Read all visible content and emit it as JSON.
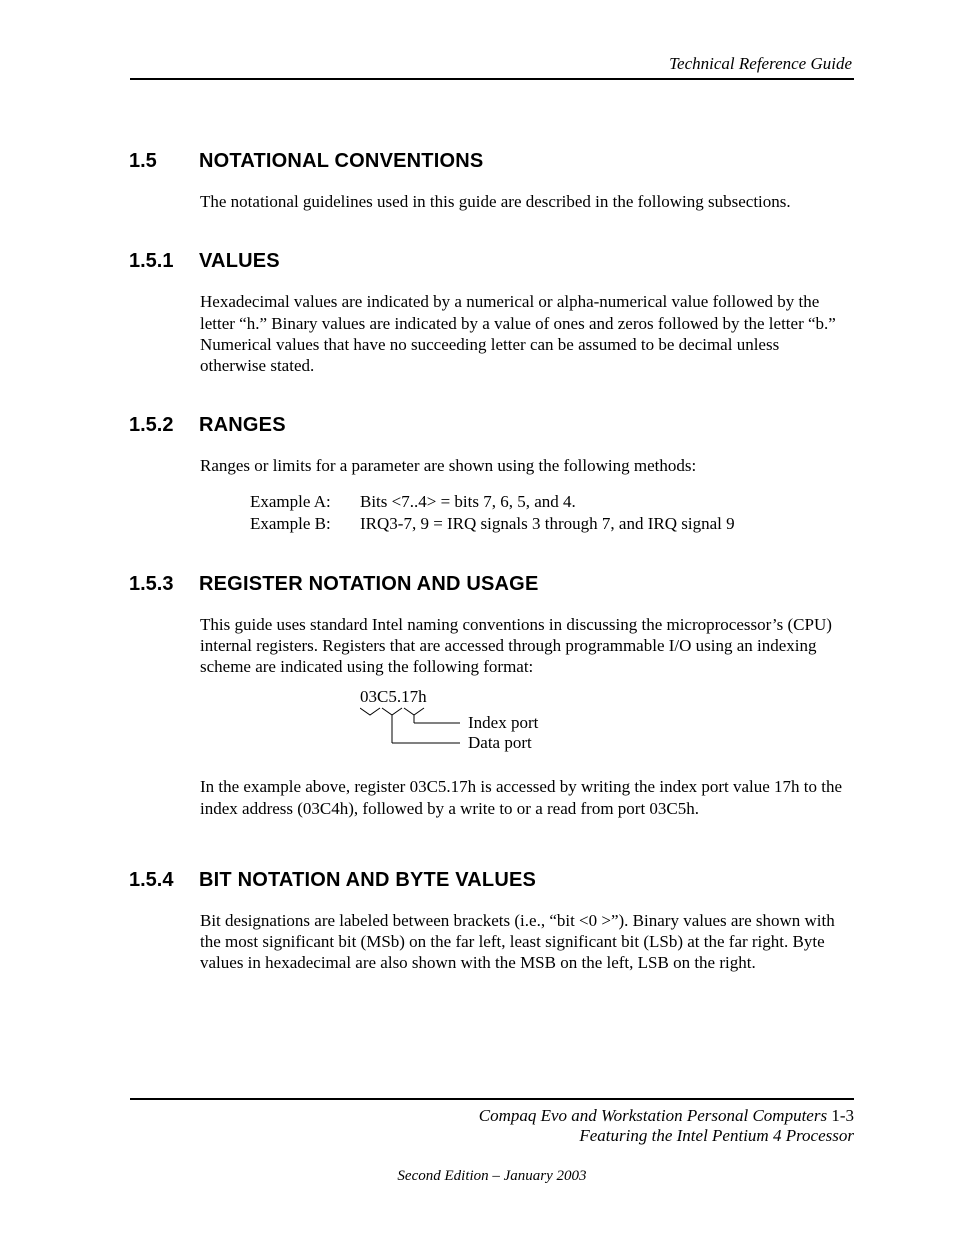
{
  "header": {
    "running_title": "Technical Reference Guide"
  },
  "sections": {
    "s15": {
      "num": "1.5",
      "title": "NOTATIONAL CONVENTIONS",
      "body": "The notational guidelines used in this guide are described in the following subsections."
    },
    "s151": {
      "num": "1.5.1",
      "title": "VALUES",
      "body": "Hexadecimal values are indicated by a numerical or alpha-numerical value followed by the letter “h.”  Binary values are indicated by a value of ones and zeros followed by the letter “b.”  Numerical values that have no succeeding letter can be assumed to be decimal unless otherwise stated."
    },
    "s152": {
      "num": "1.5.2",
      "title": "RANGES",
      "body": "Ranges or limits for a parameter are shown using the following methods:",
      "example_a_label": "Example A:",
      "example_a_text": "Bits <7..4> = bits 7, 6, 5, and 4.",
      "example_b_label": "Example B:",
      "example_b_text": "IRQ3-7, 9 = IRQ signals 3 through 7, and IRQ signal 9"
    },
    "s153": {
      "num": "1.5.3",
      "title": "REGISTER NOTATION AND USAGE",
      "body1": "This guide uses standard Intel naming conventions in discussing the microprocessor’s  (CPU) internal registers.  Registers that are accessed through programmable I/O using an indexing scheme are indicated using the following format:",
      "diagram_code": "03C5.17h",
      "diagram_label_index": "Index port",
      "diagram_label_data": "Data port",
      "body2": "In the example above, register 03C5.17h is accessed by writing the index port value 17h to the index address (03C4h), followed by a write to or a read from port 03C5h."
    },
    "s154": {
      "num": "1.5.4",
      "title": "BIT NOTATION AND BYTE VALUES",
      "body": "Bit designations are labeled between brackets (i.e., “bit <0 >”). Binary values are shown with the most significant bit (MSb) on the far left, least significant bit (LSb) at the far right. Byte values in hexadecimal are also shown with the MSB on the left, LSB on the right."
    }
  },
  "footer": {
    "line1_italic": "Compaq Evo and Workstation Personal Computers",
    "line1_pageref": "  1-3",
    "line2": "Featuring the Intel Pentium 4 Processor",
    "edition": "Second Edition – January 2003"
  }
}
